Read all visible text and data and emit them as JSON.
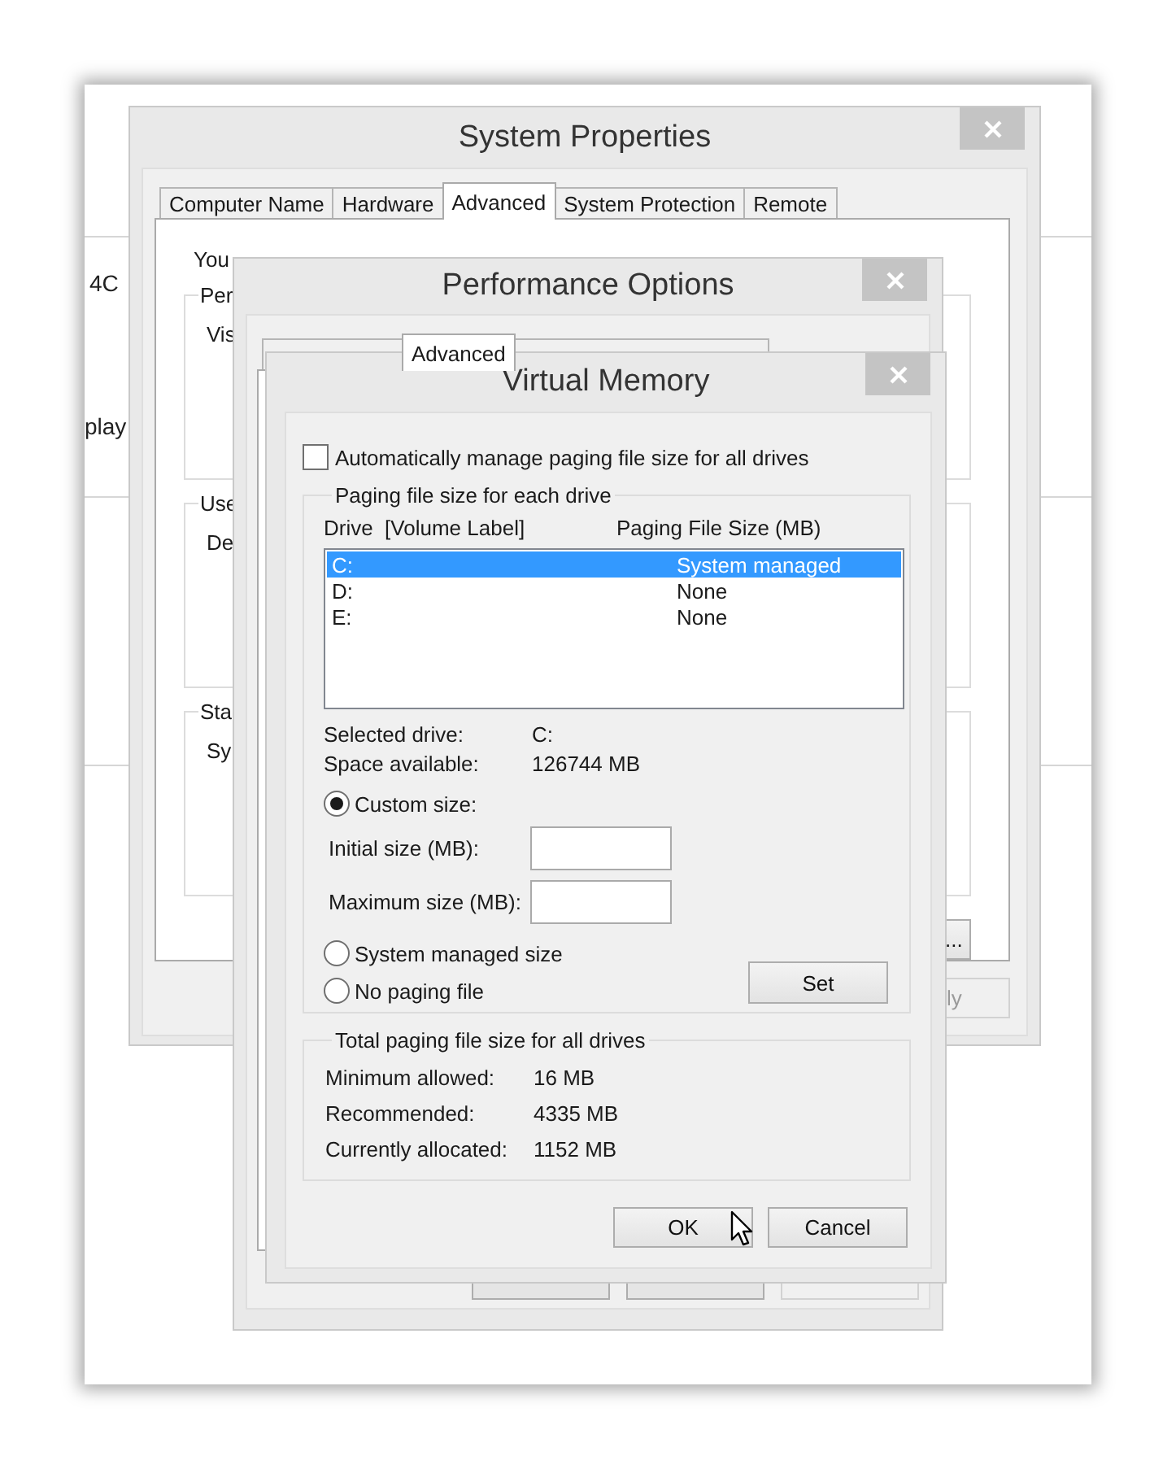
{
  "background": {
    "texts": [
      "4C",
      "play"
    ]
  },
  "system_properties": {
    "title": "System Properties",
    "tabs": [
      {
        "label": "Computer Name",
        "selected": false
      },
      {
        "label": "Hardware",
        "selected": false
      },
      {
        "label": "Advanced",
        "selected": true
      },
      {
        "label": "System Protection",
        "selected": false
      },
      {
        "label": "Remote",
        "selected": false
      }
    ],
    "notice": "You",
    "groups": [
      {
        "label": "Per",
        "text": "Vis"
      },
      {
        "label": "Use",
        "text": "De"
      },
      {
        "label": "Sta",
        "text": "Sy"
      }
    ],
    "group_button": "...",
    "buttons": [
      {
        "label": "ly",
        "disabled": true
      }
    ]
  },
  "performance_options": {
    "title": "Performance Options",
    "tabs": [
      {
        "selected": false
      },
      {
        "label": "Advanced",
        "selected": true
      },
      {
        "selected": false
      }
    ]
  },
  "virtual_memory": {
    "title": "Virtual Memory",
    "auto_manage": {
      "label": "Automatically manage paging file size for all drives",
      "checked": false
    },
    "drives_group": {
      "label": "Paging file size for each drive",
      "columns": [
        "Drive  [Volume Label]",
        "Paging File Size (MB)"
      ],
      "drives": [
        {
          "drive": "C:",
          "size": "System managed",
          "selected": true
        },
        {
          "drive": "D:",
          "size": "None",
          "selected": false
        },
        {
          "drive": "E:",
          "size": "None",
          "selected": false
        }
      ],
      "info": [
        {
          "label": "Selected drive:",
          "value": "C:"
        },
        {
          "label": "Space available:",
          "value": "126744 MB"
        }
      ],
      "size_options": [
        {
          "label": "Custom size:",
          "selected": true
        },
        {
          "label": "System managed size",
          "selected": false
        },
        {
          "label": "No paging file",
          "selected": false
        }
      ],
      "fields": [
        {
          "label": "Initial size (MB):"
        },
        {
          "label": "Maximum size (MB):"
        }
      ],
      "set_button": "Set"
    },
    "totals_group": {
      "label": "Total paging file size for all drives",
      "rows": [
        {
          "label": "Minimum allowed:",
          "value": "16 MB"
        },
        {
          "label": "Recommended:",
          "value": "4335 MB"
        },
        {
          "label": "Currently allocated:",
          "value": "1152 MB"
        }
      ]
    },
    "buttons": [
      "OK",
      "Cancel"
    ]
  }
}
